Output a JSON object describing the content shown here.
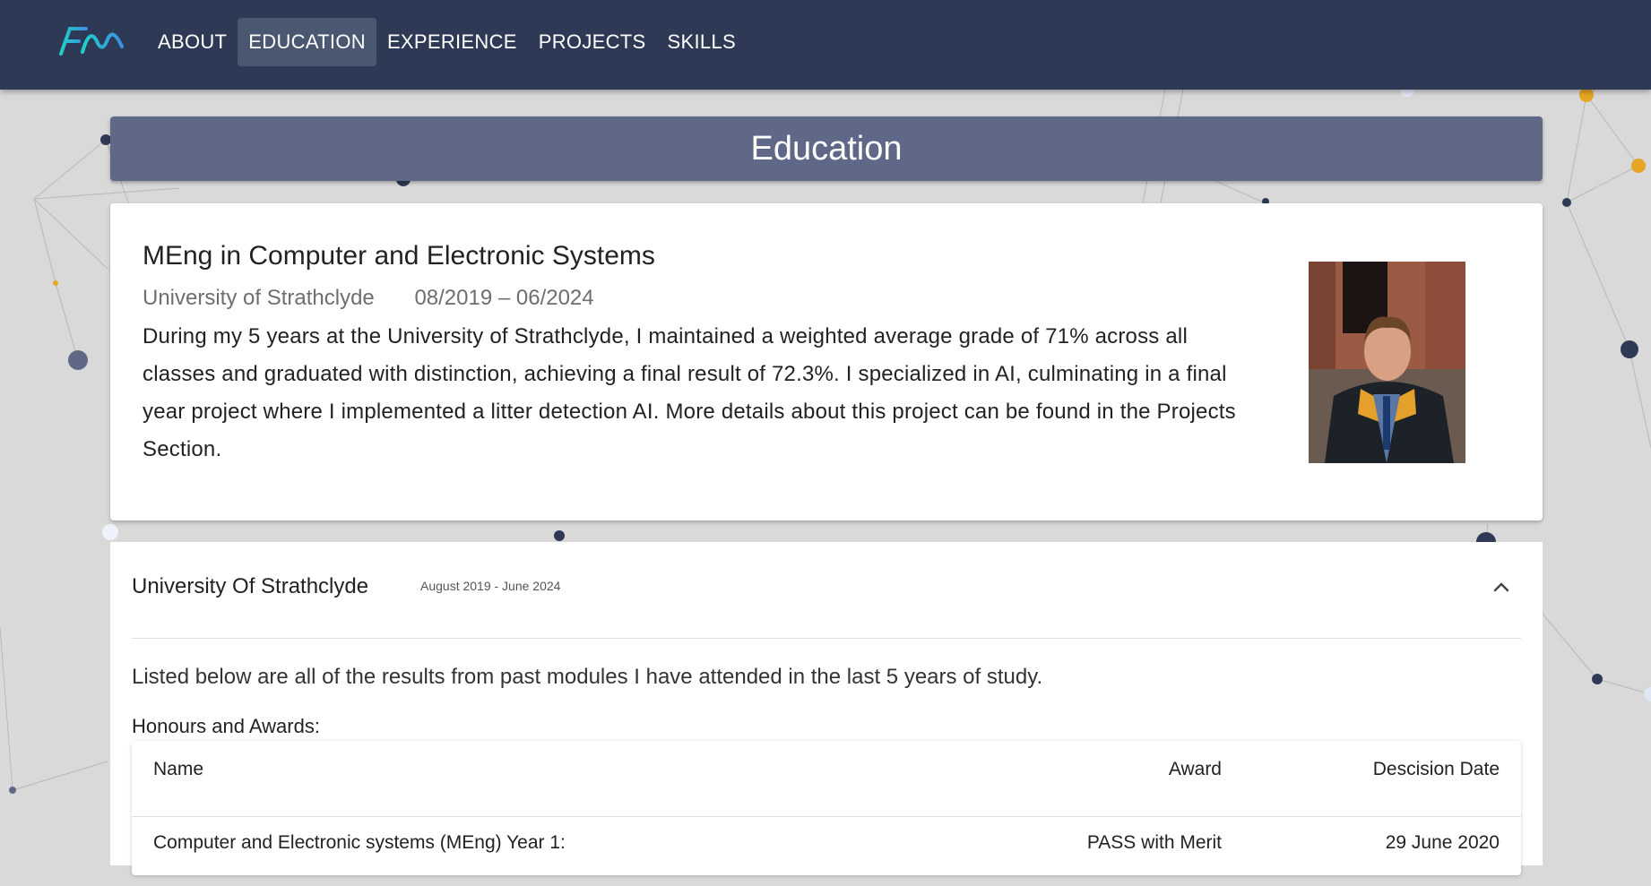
{
  "nav": {
    "items": [
      {
        "label": "ABOUT"
      },
      {
        "label": "EDUCATION"
      },
      {
        "label": "EXPERIENCE"
      },
      {
        "label": "PROJECTS"
      },
      {
        "label": "SKILLS"
      }
    ],
    "active_index": 1
  },
  "page": {
    "title": "Education"
  },
  "degree_card": {
    "degree": "MEng in Computer and Electronic Systems",
    "institution": "University of Strathclyde",
    "dates": "08/2019 – 06/2024",
    "description": "During my 5 years at the University of Strathclyde, I maintained a weighted average grade of 71% across all classes and graduated with distinction, achieving a final result of 72.3%. I specialized in AI, culminating in a final year project where I implemented a litter detection AI. More details about this project can be found in the Projects Section."
  },
  "results_panel": {
    "title": "University Of Strathclyde",
    "dates": "August 2019 - June 2024",
    "intro": "Listed below are all of the results from past modules I have attended in the last 5 years of study.",
    "honours_label": "Honours and Awards:",
    "table": {
      "headers": {
        "name": "Name",
        "award": "Award",
        "date": "Descision Date"
      },
      "rows": [
        {
          "name": "Computer and Electronic systems (MEng) Year 1:",
          "award": "PASS with Merit",
          "date": "29 June 2020"
        }
      ]
    }
  },
  "colors": {
    "topbar": "#2e3a55",
    "title_bar": "#5f6987",
    "accent_yellow": "#e5a623",
    "node_dark": "#2e3a55"
  }
}
